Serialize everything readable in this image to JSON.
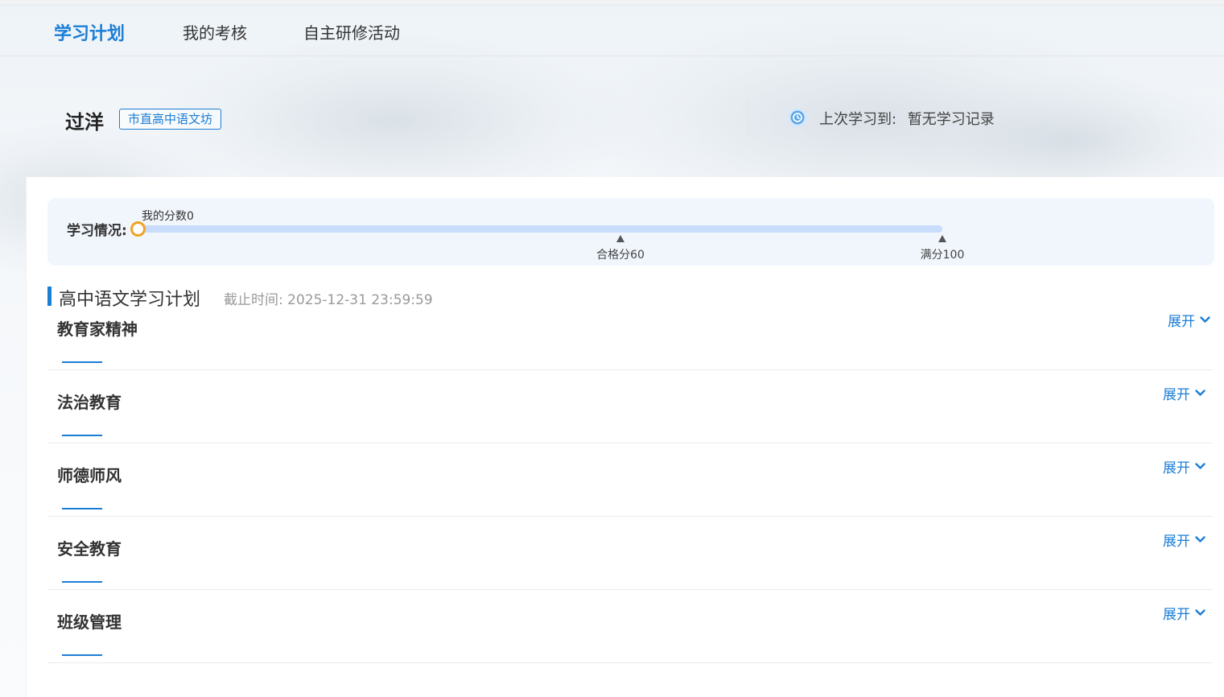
{
  "nav": {
    "items": [
      {
        "label": "学习计划",
        "active": true
      },
      {
        "label": "我的考核",
        "active": false
      },
      {
        "label": "自主研修活动",
        "active": false
      }
    ]
  },
  "profile": {
    "name": "过洋",
    "tag": "市直高中语文坊",
    "last_study_label": "上次学习到:",
    "last_study_value": "暂无学习记录",
    "last_study_icon": "history-icon"
  },
  "progress": {
    "label": "学习情况:",
    "my_score_label": "我的分数0",
    "my_score": 0,
    "pass_label": "合格分60",
    "pass_score": 60,
    "full_label": "满分100",
    "full_score": 100
  },
  "plan": {
    "title": "高中语文学习计划",
    "deadline_label": "截止时间:",
    "deadline_value": "2025-12-31 23:59:59"
  },
  "sections": [
    {
      "title": "教育家精神",
      "toggle": "展开"
    },
    {
      "title": "法治教育",
      "toggle": "展开"
    },
    {
      "title": "师德师风",
      "toggle": "展开"
    },
    {
      "title": "安全教育",
      "toggle": "展开"
    },
    {
      "title": "班级管理",
      "toggle": "展开"
    }
  ],
  "colors": {
    "accent": "#1b7ed6",
    "track": "#c9dcfb",
    "knob": "#f0a225"
  }
}
